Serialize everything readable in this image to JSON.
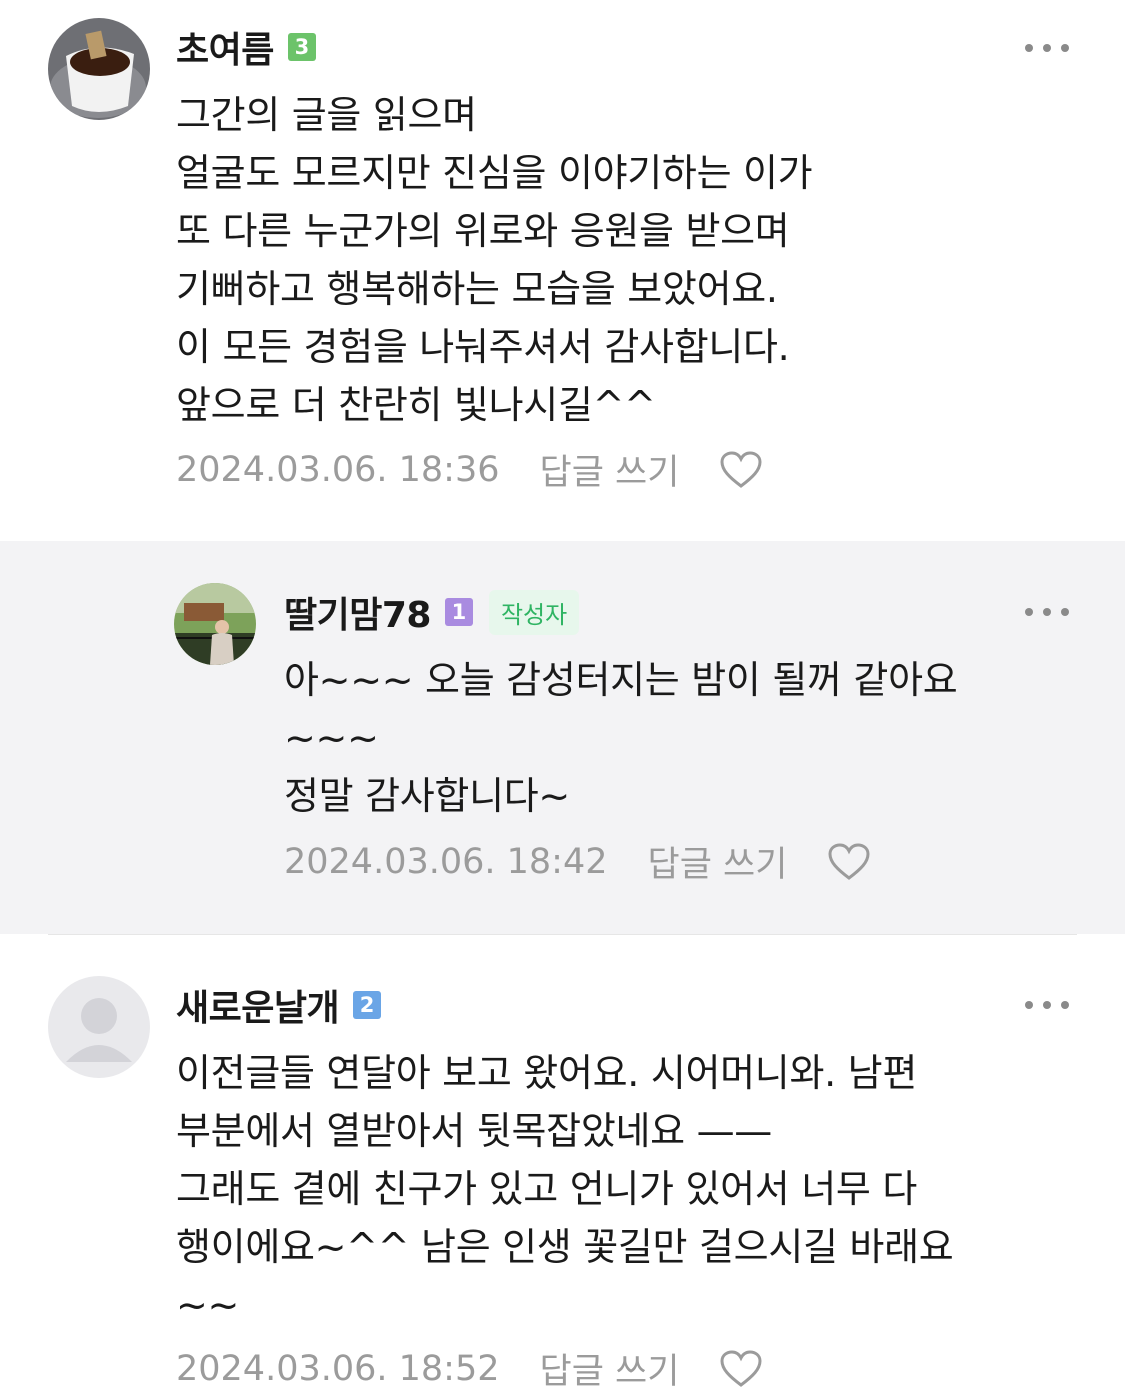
{
  "comments": [
    {
      "nickname": "초여름",
      "level": "3",
      "level_color": "#6cc36a",
      "body": "그간의 글을 읽으며\n얼굴도 모르지만 진심을 이야기하는 이가\n또 다른 누군가의 위로와 응원을 받으며\n기뻐하고 행복해하는 모습을 보았어요.\n이 모든 경험을 나눠주셔서 감사합니다.\n앞으로 더 찬란히 빛나시길^^",
      "date": "2024.03.06. 18:36",
      "reply_label": "답글 쓰기",
      "avatar_icon": "coffee-cup-icon"
    },
    {
      "nickname": "딸기맘78",
      "level": "1",
      "level_color": "#a98be0",
      "author_badge": "작성자",
      "body": "아~~~ 오늘 감성터지는 밤이 될꺼 같아요\n~~~\n정말 감사합니다~",
      "date": "2024.03.06. 18:42",
      "reply_label": "답글 쓰기",
      "avatar_icon": "person-landscape-icon"
    },
    {
      "nickname": "새로운날개",
      "level": "2",
      "level_color": "#6aa5e6",
      "body": "이전글들 연달아 보고 왔어요. 시어머니와. 남편\n부분에서 열받아서 뒷목잡았네요 ——\n그래도 곁에 친구가 있고 언니가 있어서 너무 다\n행이에요~^^ 남은 인생 꽃길만 걸으시길 바래요\n~~",
      "date": "2024.03.06. 18:52",
      "reply_label": "답글 쓰기",
      "avatar_icon": "default-person-icon"
    }
  ],
  "icons": {
    "more": "more-dots-icon",
    "like": "heart-outline-icon"
  },
  "colors": {
    "reply_background": "#f3f3f5",
    "author_badge_text": "#2fb463",
    "meta_text": "#9b9b9b"
  }
}
